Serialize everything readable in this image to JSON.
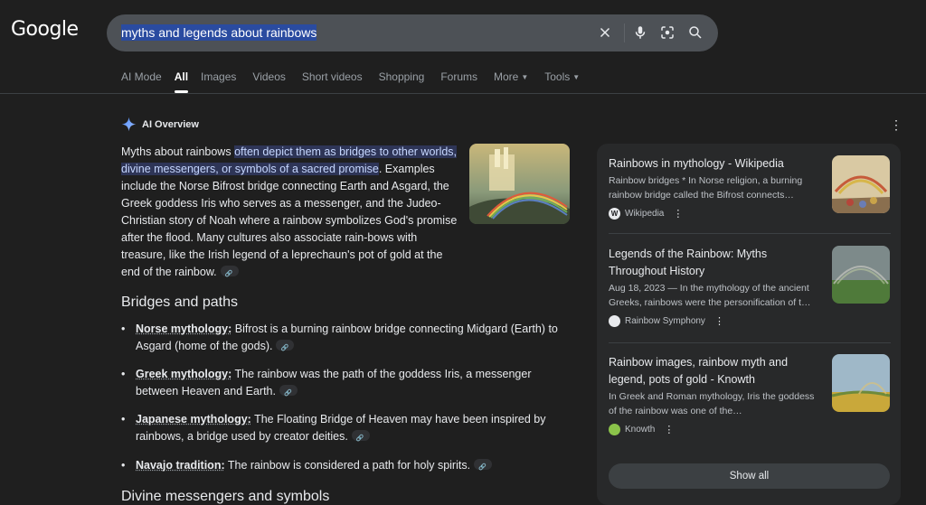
{
  "header": {
    "logo": "Google",
    "search_query": "myths and legends about rainbows"
  },
  "tabs": [
    {
      "label": "AI Mode"
    },
    {
      "label": "All"
    },
    {
      "label": "Images"
    },
    {
      "label": "Videos"
    },
    {
      "label": "Short videos"
    },
    {
      "label": "Shopping"
    },
    {
      "label": "Forums"
    },
    {
      "label": "More"
    },
    {
      "label": "Tools"
    }
  ],
  "ai_overview": {
    "title": "AI Overview",
    "intro_lead": "Myths about rainbows ",
    "intro_highlight": "often depict them as bridges to other worlds, divine messengers, or symbols of a sacred promise",
    "intro_rest": ". Examples include the Norse Bifrost bridge connecting Earth and Asgard, the Greek goddess Iris who serves as a messenger, and the Judeo-Christian story of Noah where a rainbow symbolizes God's promise after the flood. Many cultures also associate rain-bows with treasure, like the Irish legend of a leprechaun's pot of gold at the end of the rainbow.",
    "section1_heading": "Bridges and paths",
    "bullets": [
      {
        "term": "Norse mythology:",
        "text": " Bifrost is a burning rainbow bridge connecting Midgard (Earth) to Asgard (home of the gods)."
      },
      {
        "term": "Greek mythology:",
        "text": " The rainbow was the path of the goddess Iris, a messenger between Heaven and Earth."
      },
      {
        "term": "Japanese mythology:",
        "text": " The Floating Bridge of Heaven may have been inspired by rainbows, a bridge used by creator deities."
      },
      {
        "term": "Navajo tradition:",
        "text": " The rainbow is considered a path for holy spirits."
      }
    ],
    "section2_heading": "Divine messengers and symbols"
  },
  "sources": [
    {
      "title": "Rainbows in mythology - Wikipedia",
      "snippet": "Rainbow bridges * In Norse religion, a burning rainbow bridge called the Bifrost connects…",
      "site": "Wikipedia",
      "favicon": "W"
    },
    {
      "title": "Legends of the Rainbow: Myths Throughout History",
      "snippet": "Aug 18, 2023 — In the mythology of the ancient Greeks, rainbows were the personification of t…",
      "site": "Rainbow Symphony",
      "favicon": ""
    },
    {
      "title": "Rainbow images, rainbow myth and legend, pots of gold - Knowth",
      "snippet": "In Greek and Roman mythology, Iris the goddess of the rainbow was one of the…",
      "site": "Knowth",
      "favicon": ""
    }
  ],
  "show_all_label": "Show all",
  "colors": {
    "background": "#1f1f1f",
    "highlight_bg": "#2e3557",
    "panel_bg": "#28292a",
    "search_bg": "#4d5156"
  }
}
